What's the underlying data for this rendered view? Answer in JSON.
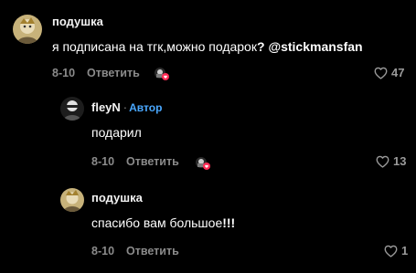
{
  "comments": [
    {
      "name": "подушка",
      "text": "я подписана на тгк,можно подарок",
      "question": "?",
      "mention": "@stickmansfan",
      "date": "8-10",
      "reply": "Ответить",
      "likes": "47"
    },
    {
      "name": "fleyN",
      "separator": "·",
      "author": "Автор",
      "text": "подарил",
      "date": "8-10",
      "reply": "Ответить",
      "likes": "13"
    },
    {
      "name": "подушка",
      "text": "спасибо вам большое",
      "emph": "!!!",
      "date": "8-10",
      "reply": "Ответить",
      "likes": "1"
    }
  ],
  "colors": {
    "author_accent": "#4aa8ff",
    "muted_text": "#8b8b8b",
    "background": "#000000"
  },
  "icons": {
    "like": "heart-outline-icon",
    "reaction": "creator-liked-avatar-badge-icon"
  }
}
